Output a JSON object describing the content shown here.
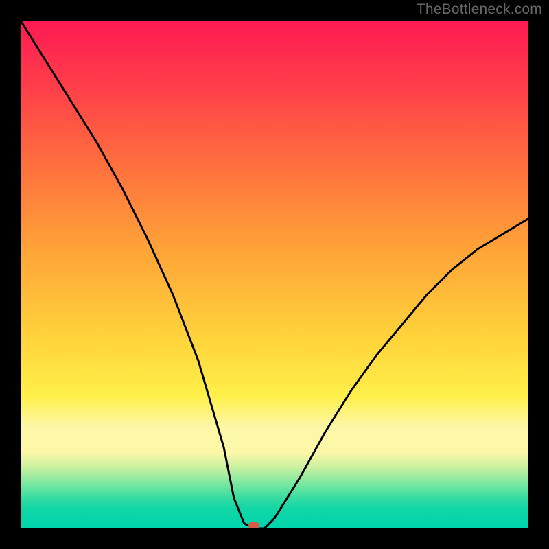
{
  "attribution": "TheBottleneck.com",
  "chart_data": {
    "type": "line",
    "title": "",
    "xlabel": "",
    "ylabel": "",
    "xlim": [
      0,
      100
    ],
    "ylim": [
      0,
      100
    ],
    "grid": false,
    "series": [
      {
        "name": "bottleneck-curve",
        "x": [
          0,
          5,
          10,
          15,
          20,
          25,
          30,
          35,
          40,
          42,
          44,
          46,
          48,
          50,
          55,
          60,
          65,
          70,
          75,
          80,
          85,
          90,
          95,
          100
        ],
        "y": [
          100,
          92,
          84,
          76,
          67,
          57,
          46,
          33,
          16,
          6,
          1,
          0,
          0,
          2,
          10,
          19,
          27,
          34,
          40,
          46,
          51,
          55,
          58,
          61
        ]
      }
    ],
    "marker": {
      "x": 46,
      "y": 0,
      "name": "optimal-point"
    },
    "background_gradient": {
      "stops": [
        {
          "pos": 0,
          "color": "#ff1a53"
        },
        {
          "pos": 28,
          "color": "#ff6e3e"
        },
        {
          "pos": 62,
          "color": "#ffd23a"
        },
        {
          "pos": 82,
          "color": "#fdf7a8"
        },
        {
          "pos": 100,
          "color": "#00d4ad"
        }
      ]
    }
  }
}
